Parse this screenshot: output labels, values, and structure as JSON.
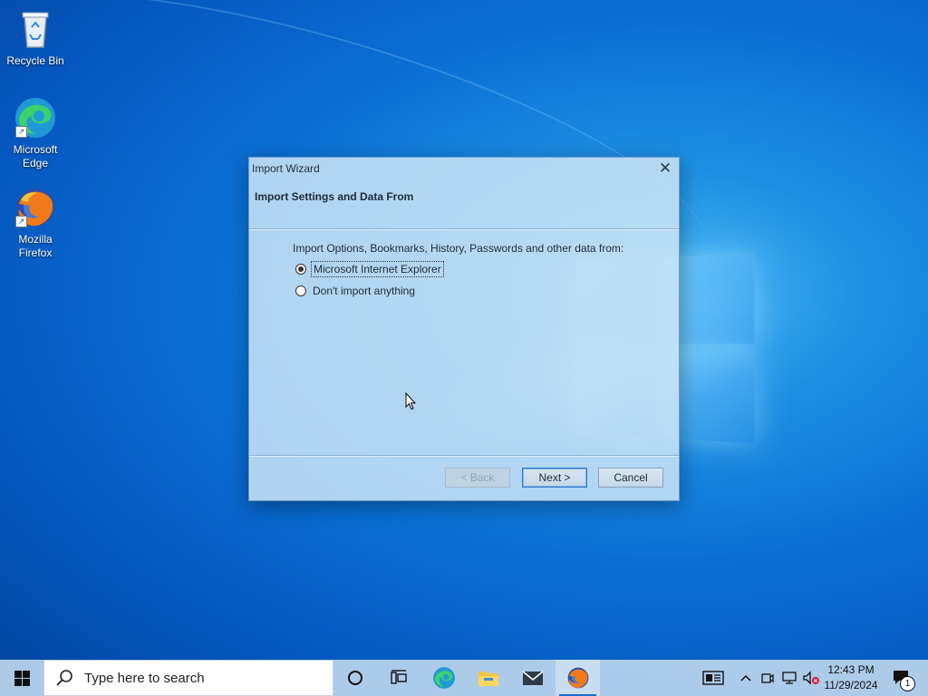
{
  "desktop": {
    "icons": [
      {
        "label": "Recycle Bin",
        "icon": "recycle-bin-icon"
      },
      {
        "label": "Microsoft Edge",
        "icon": "edge-icon"
      },
      {
        "label": "Mozilla Firefox",
        "icon": "firefox-icon"
      }
    ]
  },
  "dialog": {
    "title": "Import Wizard",
    "close_icon": "close-icon",
    "header": "Import Settings and Data From",
    "prompt": "Import Options, Bookmarks, History, Passwords and other data from:",
    "options": [
      {
        "label": "Microsoft Internet Explorer",
        "checked": true
      },
      {
        "label": "Don't import anything",
        "checked": false
      }
    ],
    "buttons": {
      "back": "< Back",
      "next": "Next >",
      "cancel": "Cancel"
    }
  },
  "taskbar": {
    "search_placeholder": "Type here to search",
    "pinned": [
      "task-view-icon",
      "edge-icon",
      "file-explorer-icon",
      "mail-icon",
      "firefox-icon"
    ],
    "active_app": "firefox-icon",
    "time": "12:43 PM",
    "date": "11/29/2024",
    "notification_count": "1"
  },
  "colors": {
    "accent": "#1a6ed8",
    "desktop_bg": "#0a6fd4"
  }
}
